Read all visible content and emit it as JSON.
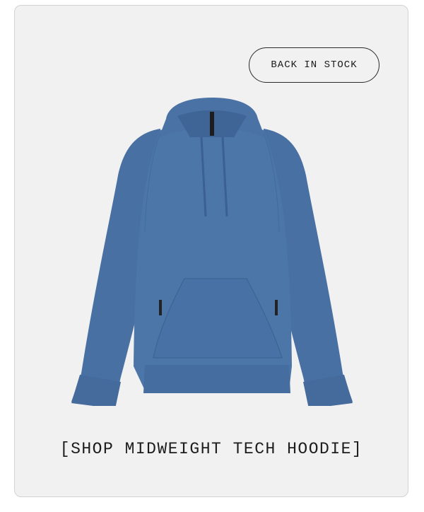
{
  "badge": {
    "label": "BACK IN STOCK"
  },
  "product": {
    "image_subject": "hoodie",
    "color": "#4a73a6"
  },
  "cta": {
    "label": "[SHOP MIDWEIGHT TECH HOODIE]"
  }
}
